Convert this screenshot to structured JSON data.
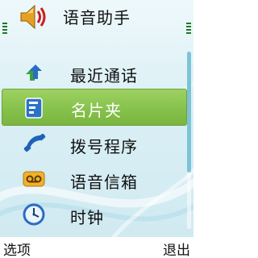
{
  "header": {
    "title": "语音助手",
    "app_icon": "speaker-icon"
  },
  "menu": {
    "items": [
      {
        "label": "最近通话",
        "icon": "recent-calls-icon"
      },
      {
        "label": "名片夹",
        "icon": "contacts-icon",
        "selected": true
      },
      {
        "label": "拨号程序",
        "icon": "dialer-icon"
      },
      {
        "label": "语音信箱",
        "icon": "voicemail-icon"
      },
      {
        "label": "时钟",
        "icon": "clock-icon"
      }
    ]
  },
  "softkeys": {
    "left": "选项",
    "right": "退出"
  },
  "colors": {
    "selection": "#86c24b",
    "background": "#d9eff5",
    "accent": "#1a7a2a"
  }
}
